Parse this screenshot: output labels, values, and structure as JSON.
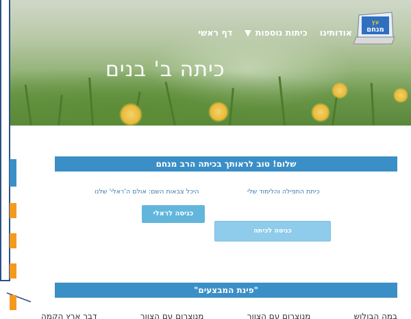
{
  "site": {
    "logo_text": "עץ מנחם",
    "nav": [
      {
        "label": "דף ראשי"
      },
      {
        "label": "כיתות נוספות",
        "has_dropdown": true
      },
      {
        "label": "אודותינו"
      }
    ],
    "page_title": "כיתה ב' בנים"
  },
  "welcome": {
    "header": "שלום! טוב לראותך בכיתה הרב מנחם",
    "link_class": "כיתת התפילה והלימוד שלי",
    "link_army": "היכל צבאות השם: אולם ה'ראלי' שלנו",
    "rally_button": "כניסה לראלי",
    "class_button": "כניסה לכיתה"
  },
  "operations": {
    "header": "\"פינת המבצעים\"",
    "columns": [
      "דבר ארץ הקמה",
      "מנוצרום עם הצוור",
      "מנוצרום עם הצוור",
      "במה הבולוש"
    ]
  },
  "colors": {
    "header_blue": "#3a8fc6",
    "button_blue": "#62b6dc",
    "button_light": "#8fcbea",
    "link_blue": "#3c7ab0",
    "frame_navy": "#2d4f86",
    "accent_orange": "#f39a1e"
  }
}
